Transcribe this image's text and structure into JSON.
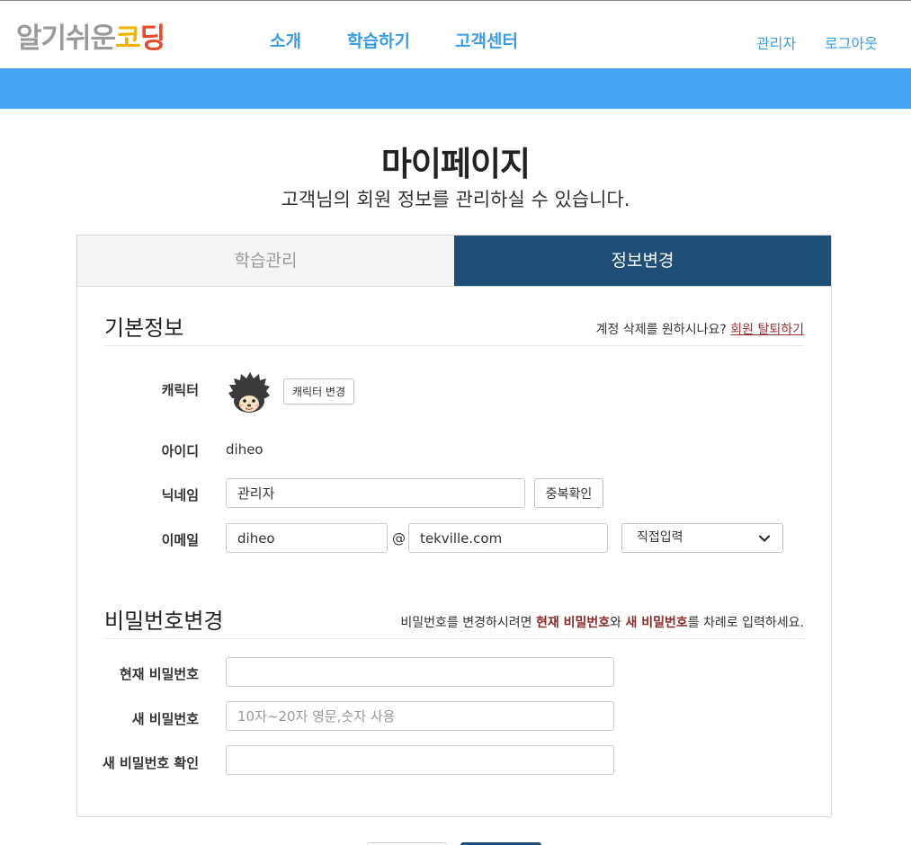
{
  "header": {
    "logo": {
      "part1": "알기쉬운",
      "part2": "코",
      "part3": "딩"
    },
    "nav": [
      {
        "label": "소개"
      },
      {
        "label": "학습하기"
      },
      {
        "label": "고객센터"
      }
    ],
    "util": [
      {
        "label": "관리자"
      },
      {
        "label": "로그아웃"
      }
    ]
  },
  "page": {
    "title": "마이페이지",
    "subtitle": "고객님의 회원 정보를 관리하실 수 있습니다."
  },
  "tabs": [
    {
      "label": "학습관리",
      "active": false
    },
    {
      "label": "정보변경",
      "active": true
    }
  ],
  "basic": {
    "title": "기본정보",
    "note_prefix": "계정 삭제를 원하시나요?",
    "withdraw_link": "회원 탈퇴하기",
    "character_label": "캐릭터",
    "character_button": "캐릭터 변경",
    "id_label": "아이디",
    "id_value": "diheo",
    "nickname_label": "닉네임",
    "nickname_value": "관리자",
    "dup_check_button": "중복확인",
    "email_label": "이메일",
    "email_local": "diheo",
    "email_at": "@",
    "email_domain": "tekville.com",
    "email_select": "직접입력"
  },
  "password": {
    "title": "비밀번호변경",
    "note_a": "비밀번호를 변경하시려면 ",
    "note_b": "현재 비밀번호",
    "note_c": "와 ",
    "note_d": "새 비밀번호",
    "note_e": "를 차례로 입력하세요.",
    "current_label": "현재 비밀번호",
    "current_value": "",
    "new_label": "새 비밀번호",
    "new_placeholder": "10자~20자 영문,숫자 사용",
    "confirm_label": "새 비밀번호 확인",
    "confirm_value": ""
  },
  "colors": {
    "accent": "#45a5f7",
    "nav_text": "#3a9ce4",
    "tab_active": "#1f4e79",
    "emphasis_red": "#8b2a2a"
  },
  "icons": {
    "avatar": "hedgehog-character-avatar",
    "select_arrow": "chevron-down-icon"
  }
}
